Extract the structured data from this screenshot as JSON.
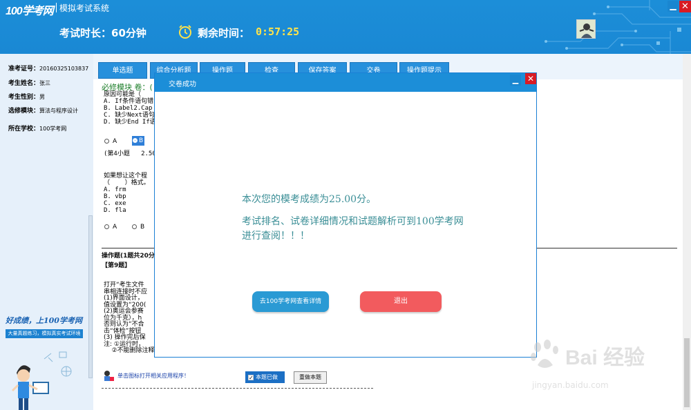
{
  "header": {
    "logo": "100学考网",
    "app_title": "模拟考试系统",
    "duration": "考试时长：60分钟",
    "remain_label": "剩余时间：",
    "remain_time": "0:57:25"
  },
  "candidate": {
    "ticket_label": "准考证号：",
    "ticket_value": "20160325103837",
    "name_label": "考生姓名：",
    "name_value": "张三",
    "gender_label": "考生性别：",
    "gender_value": "男",
    "module_label": "选修模块：",
    "module_value": "算法与程序设计",
    "school_label": "所在学校：",
    "school_value": "100学考网"
  },
  "promo": {
    "slogan": "好成绩，上100学考网",
    "sub": "大量真题练习，模拟真实考试环境"
  },
  "tabs": [
    "单选题",
    "综合分析题",
    "操作题",
    "检查",
    "保存答案",
    "交卷",
    "操作题提示"
  ],
  "main": {
    "module_heading": "必修模块 卷：(",
    "q3_lines": "原因可能是（\nA. If条件语句错\nB. Label2.Cap\nC. 缺少Next语句\nD. 缺少End If语",
    "q3_options": [
      "A",
      "B"
    ],
    "q4_header": "(第4小题   2.50分",
    "q4_lines": "如果想让这个程\n（    ）格式。\nA. frm\nB. vbp\nC. exe\nD. fla",
    "q4_options": [
      "A",
      "B"
    ],
    "op_header": "操作题(1题共20分",
    "op_no": "【第9题】",
    "op_text": "打开“考生文件\n串相连接时不应\n(1)界面设计，\n值设置为“200(\n(2)奥运会参赛\n位为千克），h\n否则认为“不合\n击“体检”按钮\n(3) 操作完后保\n注: ①运行时，\n    ②不能删除注释语句。",
    "open_link": "单击图标打开相关应用程序！",
    "done_label": "本题已做",
    "redo_label": "重做本题"
  },
  "modal": {
    "title": "交卷成功",
    "score_text": "本次您的模考成绩为25.00分。",
    "info_text": "考试排名、试卷详细情况和试题解析可到100学考网进行查阅！！！",
    "details_button": "去100学考网查看详情",
    "exit_button": "退出"
  },
  "watermark": {
    "brand": "Bai 经验",
    "url": "jingyan.baidu.com"
  },
  "colors": {
    "header_blue": "#1c8ed8",
    "tab_blue": "#2790dc",
    "exit_red": "#f25b5e",
    "details_blue": "#2a9ad4",
    "timer_yellow": "#ffe34a",
    "modal_text": "#3a8e96"
  }
}
